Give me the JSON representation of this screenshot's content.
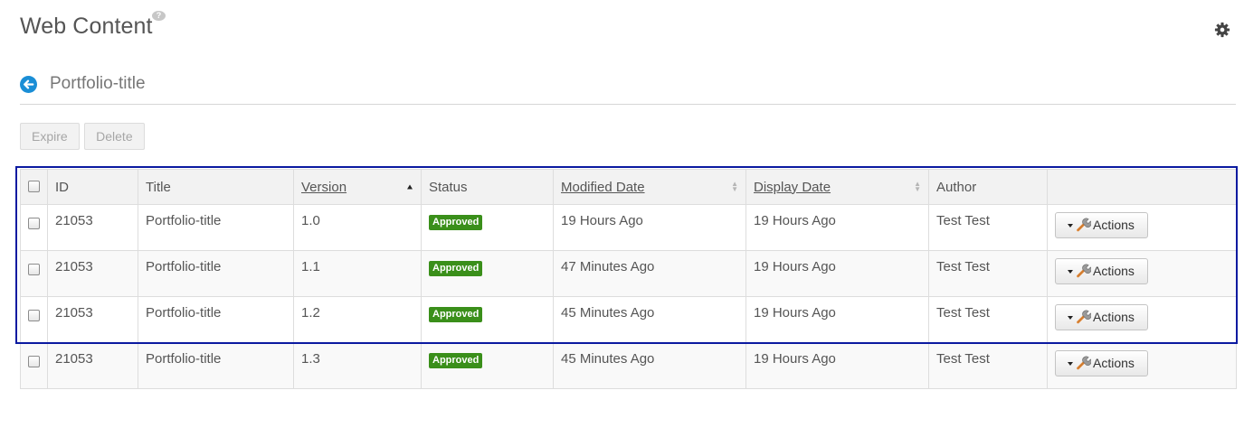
{
  "portlet": {
    "title": "Web Content",
    "help_symbol": "?"
  },
  "header": {
    "title": "Portfolio-title"
  },
  "toolbar": {
    "expire_label": "Expire",
    "delete_label": "Delete"
  },
  "table": {
    "columns": {
      "id": "ID",
      "title": "Title",
      "version": "Version",
      "status": "Status",
      "modified": "Modified Date",
      "display": "Display Date",
      "author": "Author"
    },
    "rows": [
      {
        "id": "21053",
        "title": "Portfolio-title",
        "version": "1.0",
        "status": "Approved",
        "modified": "19 Hours Ago",
        "display": "19 Hours Ago",
        "author": "Test Test",
        "action": "Actions"
      },
      {
        "id": "21053",
        "title": "Portfolio-title",
        "version": "1.1",
        "status": "Approved",
        "modified": "47 Minutes Ago",
        "display": "19 Hours Ago",
        "author": "Test Test",
        "action": "Actions"
      },
      {
        "id": "21053",
        "title": "Portfolio-title",
        "version": "1.2",
        "status": "Approved",
        "modified": "45 Minutes Ago",
        "display": "19 Hours Ago",
        "author": "Test Test",
        "action": "Actions"
      },
      {
        "id": "21053",
        "title": "Portfolio-title",
        "version": "1.3",
        "status": "Approved",
        "modified": "45 Minutes Ago",
        "display": "19 Hours Ago",
        "author": "Test Test",
        "action": "Actions"
      }
    ]
  },
  "colors": {
    "approved_badge": "#3a8f1a",
    "back_icon": "#1a8ed6",
    "highlight_border": "#0a1aa0"
  },
  "icons": {
    "help": "help-icon",
    "settings": "gear-icon",
    "back": "back-arrow-icon",
    "actions_caret": "caret-down-icon",
    "actions_tool": "wrench-icon"
  }
}
